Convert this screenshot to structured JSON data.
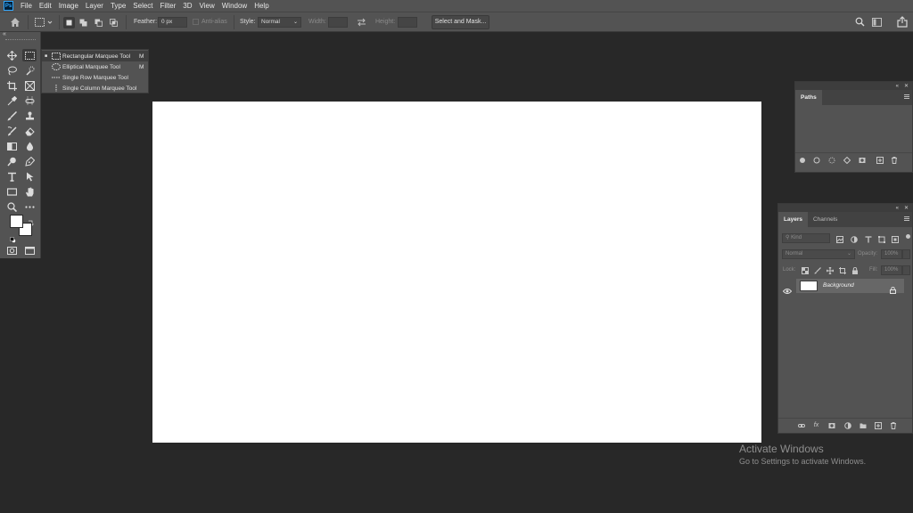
{
  "app": {
    "logo_text": "Ps",
    "menu": [
      "File",
      "Edit",
      "Image",
      "Layer",
      "Type",
      "Select",
      "Filter",
      "3D",
      "View",
      "Window",
      "Help"
    ]
  },
  "options": {
    "feather_label": "Feather:",
    "feather_value": "0 px",
    "antialias_label": "Anti-alias",
    "style_label": "Style:",
    "style_value": "Normal",
    "width_label": "Width:",
    "height_label": "Height:",
    "select_mask_label": "Select and Mask..."
  },
  "flyout": {
    "items": [
      {
        "label": "Rectangular Marquee Tool",
        "shortcut": "M",
        "selected": true
      },
      {
        "label": "Elliptical Marquee Tool",
        "shortcut": "M",
        "selected": false
      },
      {
        "label": "Single Row Marquee Tool",
        "shortcut": "",
        "selected": false
      },
      {
        "label": "Single Column Marquee Tool",
        "shortcut": "",
        "selected": false
      }
    ]
  },
  "paths_panel": {
    "tab_label": "Paths"
  },
  "layers_panel": {
    "tabs": [
      "Layers",
      "Channels"
    ],
    "kind_placeholder": "Kind",
    "blend_mode": "Normal",
    "opacity_label": "Opacity:",
    "opacity_value": "100%",
    "lock_label": "Lock:",
    "fill_label": "Fill:",
    "fill_value": "100%",
    "layers": [
      {
        "name": "Background",
        "visible": true,
        "locked": true
      }
    ]
  },
  "watermark": {
    "title": "Activate Windows",
    "subtitle": "Go to Settings to activate Windows."
  },
  "colors": {
    "ui_panel": "#535353",
    "workspace": "#282828",
    "canvas": "#ffffff",
    "foreground": "#ffffff",
    "background": "#ffffff"
  }
}
